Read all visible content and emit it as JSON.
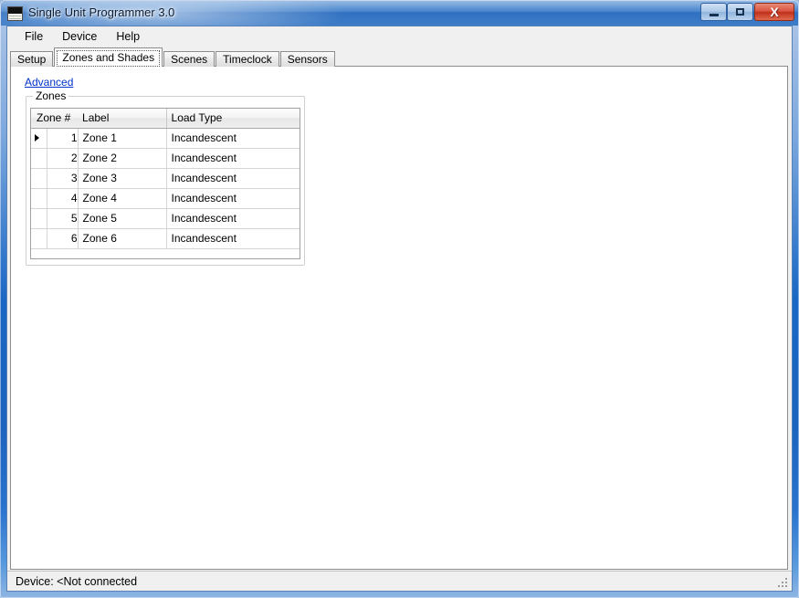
{
  "window": {
    "title": "Single Unit Programmer 3.0",
    "icon": "app-panel-icon",
    "controls": {
      "minimize_label": "–",
      "maximize_label": "□",
      "close_label": "X"
    },
    "frame_color": "#1966c4",
    "titlebar_color": "#3f7ec9"
  },
  "menubar": {
    "items": [
      {
        "label": "File"
      },
      {
        "label": "Device"
      },
      {
        "label": "Help"
      }
    ]
  },
  "tabs": {
    "active_index": 1,
    "items": [
      {
        "label": "Setup"
      },
      {
        "label": "Zones and Shades"
      },
      {
        "label": "Scenes"
      },
      {
        "label": "Timeclock"
      },
      {
        "label": "Sensors"
      }
    ]
  },
  "page": {
    "advanced_link": "Advanced",
    "group_label": "Zones",
    "grid": {
      "columns": [
        "Zone #",
        "Label",
        "Load Type"
      ],
      "selected_row": 0,
      "selected_column": 1,
      "rows": [
        {
          "num": "1",
          "label": "Zone 1",
          "load_type": "Incandescent",
          "current": true
        },
        {
          "num": "2",
          "label": "Zone 2",
          "load_type": "Incandescent",
          "current": false
        },
        {
          "num": "3",
          "label": "Zone 3",
          "load_type": "Incandescent",
          "current": false
        },
        {
          "num": "4",
          "label": "Zone 4",
          "load_type": "Incandescent",
          "current": false
        },
        {
          "num": "5",
          "label": "Zone 5",
          "load_type": "Incandescent",
          "current": false
        },
        {
          "num": "6",
          "label": "Zone 6",
          "load_type": "Incandescent",
          "current": false
        }
      ]
    },
    "selection_color": "#3399ff",
    "link_color": "#0033cc"
  },
  "statusbar": {
    "text": "Device: <Not connected"
  }
}
